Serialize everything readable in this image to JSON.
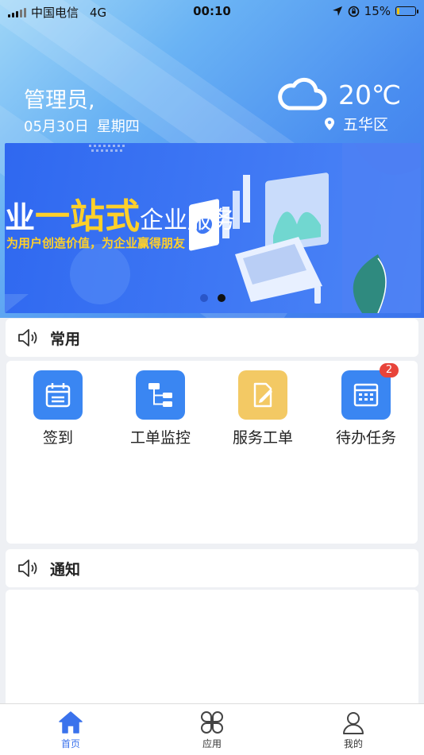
{
  "status_bar": {
    "carrier": "中国电信",
    "network": "4G",
    "time": "00:10",
    "battery": "15%",
    "battery_level": 0.15
  },
  "header": {
    "greeting": "管理员,",
    "date": "05月30日",
    "weekday": "星期四",
    "temperature": "20℃",
    "location": "五华区"
  },
  "banner": {
    "title_prefix": "业",
    "title_highlight": "一站式",
    "title_rest": "企业服务",
    "subtitle": "为用户创造价值，为企业赢得朋友",
    "slides": 2,
    "active_slide": 2
  },
  "common_section": {
    "title": "常用"
  },
  "apps": [
    {
      "label": "签到",
      "icon": "calendar-icon",
      "color": "#3a86f2"
    },
    {
      "label": "工单监控",
      "icon": "tree-structure-icon",
      "color": "#3a86f2"
    },
    {
      "label": "服务工单",
      "icon": "edit-document-icon",
      "color": "#f3c964"
    },
    {
      "label": "待办任务",
      "icon": "table-grid-icon",
      "color": "#3a86f2",
      "badge": "2"
    }
  ],
  "notice_section": {
    "title": "通知"
  },
  "tab_bar": {
    "items": [
      {
        "label": "首页",
        "icon": "home-icon"
      },
      {
        "label": "应用",
        "icon": "apps-grid-icon"
      },
      {
        "label": "我的",
        "icon": "user-icon"
      }
    ],
    "active": 0
  },
  "colors": {
    "accent": "#3a72ec",
    "badge": "#e8443a",
    "banner_highlight": "#ffd02a"
  }
}
